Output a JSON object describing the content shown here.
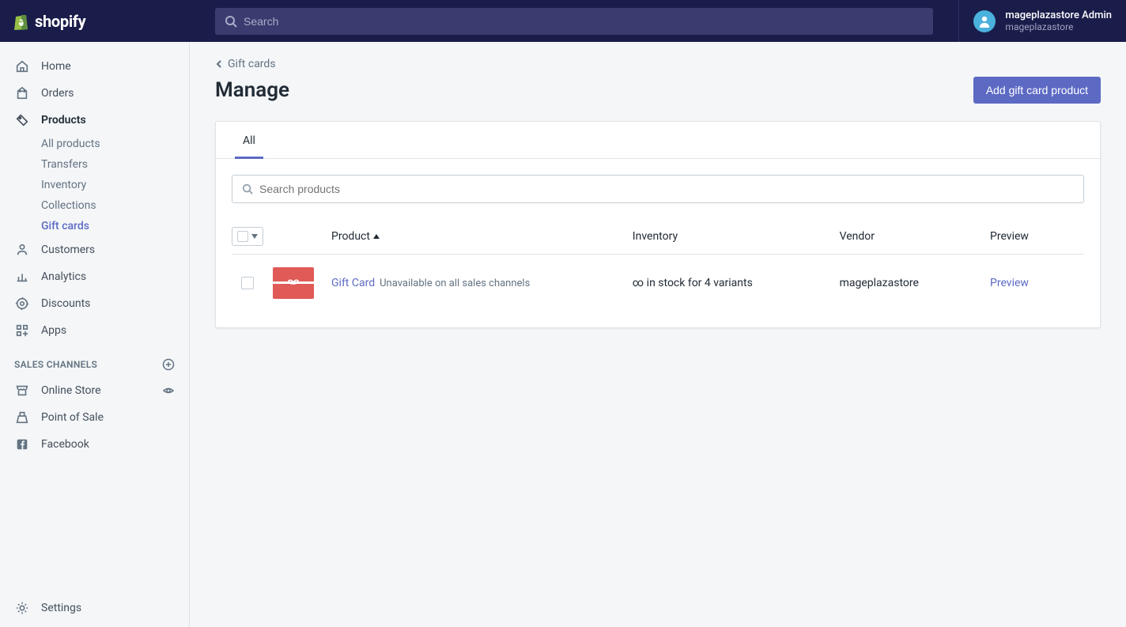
{
  "header": {
    "brand": "shopify",
    "search_placeholder": "Search",
    "profile_name": "mageplazastore Admin",
    "profile_store": "mageplazastore"
  },
  "sidebar": {
    "nav": [
      {
        "label": "Home"
      },
      {
        "label": "Orders"
      },
      {
        "label": "Products"
      }
    ],
    "products_sub": [
      {
        "label": "All products"
      },
      {
        "label": "Transfers"
      },
      {
        "label": "Inventory"
      },
      {
        "label": "Collections"
      },
      {
        "label": "Gift cards"
      }
    ],
    "nav2": [
      {
        "label": "Customers"
      },
      {
        "label": "Analytics"
      },
      {
        "label": "Discounts"
      },
      {
        "label": "Apps"
      }
    ],
    "section_header": "SALES CHANNELS",
    "channels": [
      {
        "label": "Online Store"
      },
      {
        "label": "Point of Sale"
      },
      {
        "label": "Facebook"
      }
    ],
    "settings": "Settings"
  },
  "page": {
    "breadcrumb": "Gift cards",
    "title": "Manage",
    "primary_action": "Add gift card product",
    "tab_all": "All",
    "search_placeholder": "Search products",
    "columns": {
      "product": "Product",
      "inventory": "Inventory",
      "vendor": "Vendor",
      "preview": "Preview"
    },
    "rows": [
      {
        "name": "Gift Card",
        "meta": "Unavailable on all sales channels",
        "inventory": "∞ in stock for 4 variants",
        "vendor": "mageplazastore",
        "preview": "Preview"
      }
    ]
  }
}
